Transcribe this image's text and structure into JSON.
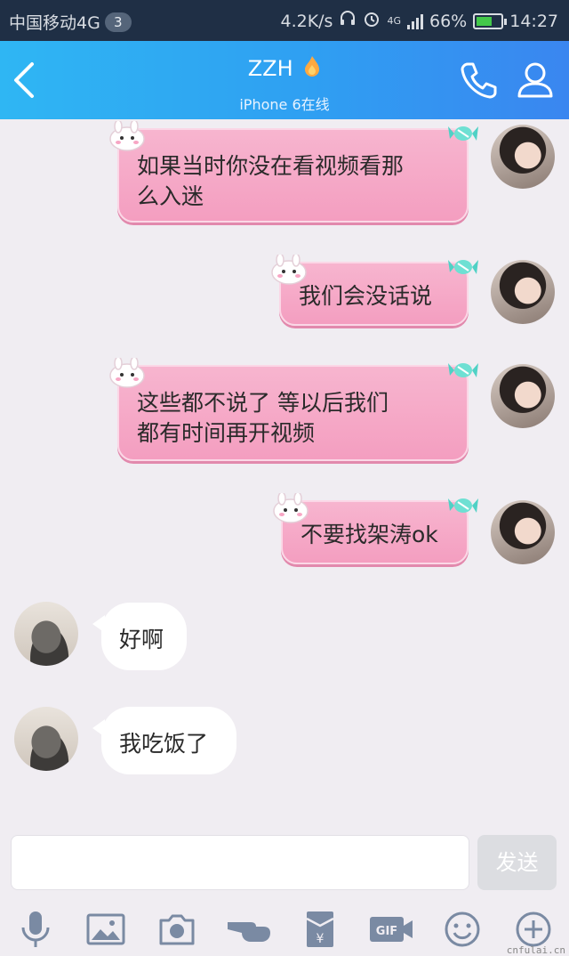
{
  "status_bar": {
    "carrier": "中国移动4G",
    "notification_count": "3",
    "speed": "4.2K/s",
    "network": "4G",
    "battery": "66%",
    "time": "14:27"
  },
  "header": {
    "title": "ZZH",
    "subtitle": "iPhone 6在线",
    "back_icon": "chevron-left-icon",
    "call_icon": "phone-icon",
    "profile_icon": "person-icon"
  },
  "messages": [
    {
      "side": "right",
      "text_lines": [
        "如果当时你没在看视频看那",
        "么入迷"
      ]
    },
    {
      "side": "right",
      "text_lines": [
        "我们会没话说"
      ]
    },
    {
      "side": "right",
      "text_lines": [
        "这些都不说了 等以后我们",
        "都有时间再开视频"
      ]
    },
    {
      "side": "right",
      "text_lines": [
        "不要找架涛ok"
      ]
    },
    {
      "side": "left",
      "text_lines": [
        "好啊"
      ]
    },
    {
      "side": "left",
      "text_lines": [
        "我吃饭了"
      ]
    }
  ],
  "input": {
    "value": "",
    "send_label": "发送"
  },
  "toolbar": [
    {
      "icon": "microphone-icon"
    },
    {
      "icon": "image-icon"
    },
    {
      "icon": "camera-icon"
    },
    {
      "icon": "poke-hand-icon"
    },
    {
      "icon": "red-packet-icon"
    },
    {
      "icon": "gif-icon"
    },
    {
      "icon": "emoji-icon"
    },
    {
      "icon": "plus-icon"
    }
  ],
  "watermark": "cnfulai.cn",
  "colors": {
    "header_gradient_start": "#2fb6f3",
    "header_gradient_end": "#3a86f0",
    "pink_bubble": "#f49ec0",
    "chat_background": "#f0edf2",
    "status_bar": "#1f2f45"
  }
}
